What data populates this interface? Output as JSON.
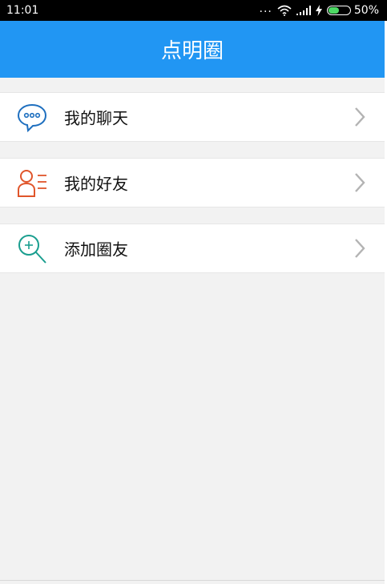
{
  "status_bar": {
    "time": "11:01",
    "more": "...",
    "battery": "50%",
    "battery_level": 0.5
  },
  "header": {
    "title": "点明圈"
  },
  "menu": {
    "items": [
      {
        "label": "我的聊天",
        "icon": "chat-bubble-icon",
        "color": "#1e6fbf"
      },
      {
        "label": "我的好友",
        "icon": "contacts-icon",
        "color": "#e0552b"
      },
      {
        "label": "添加圈友",
        "icon": "search-add-icon",
        "color": "#1a9e8f"
      }
    ]
  },
  "colors": {
    "header_bg": "#2196f3",
    "page_bg": "#f2f2f2",
    "chevron": "#b3b3b3"
  }
}
